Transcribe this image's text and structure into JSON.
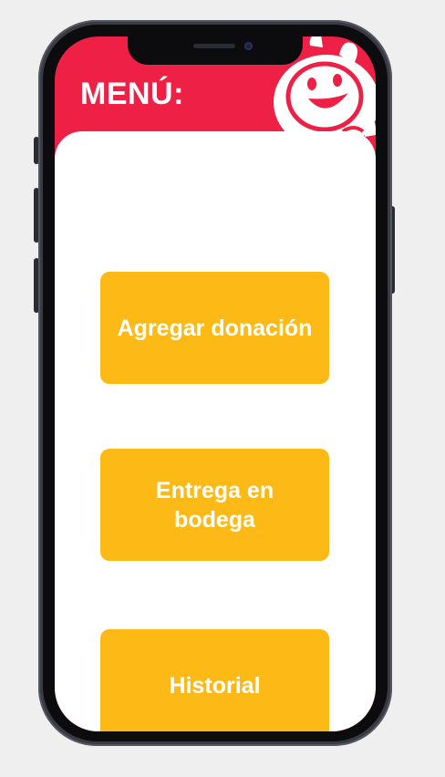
{
  "header": {
    "title": "MENÚ:"
  },
  "menu": {
    "items": [
      {
        "label": "Agregar donación"
      },
      {
        "label": "Entrega en bodega"
      },
      {
        "label": "Historial"
      }
    ]
  },
  "colors": {
    "brand_red": "#ee2045",
    "button_yellow": "#fdba17",
    "background": "#efefef",
    "card_white": "#ffffff"
  },
  "icons": {
    "mascot": "smiling-mascot-icon"
  }
}
